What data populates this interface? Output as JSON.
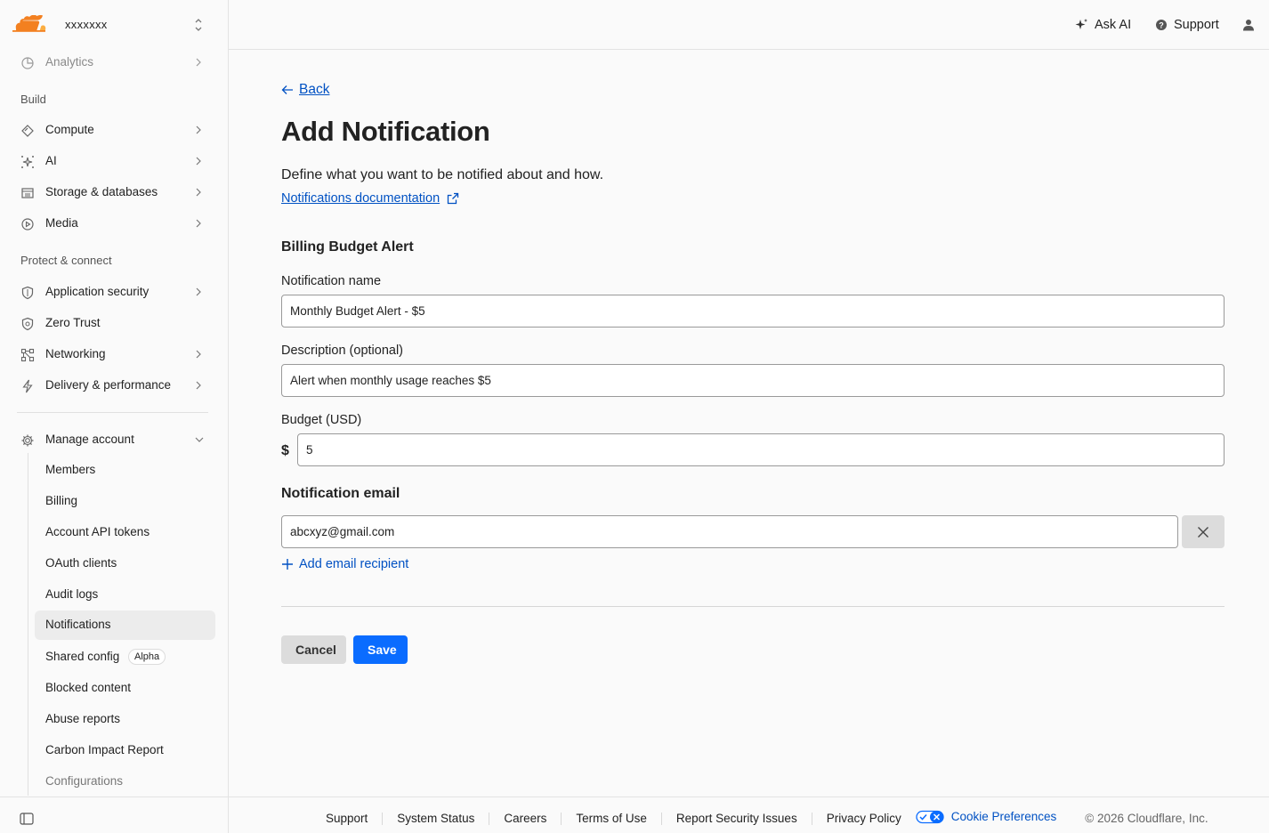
{
  "account": {
    "name": "xxxxxxx"
  },
  "topbar": {
    "ask_ai": "Ask AI",
    "support": "Support"
  },
  "sidebar": {
    "analytics": "Analytics",
    "build_heading": "Build",
    "build_items": [
      "Compute",
      "AI",
      "Storage & databases",
      "Media"
    ],
    "protect_heading": "Protect & connect",
    "protect_items": [
      "Application security",
      "Zero Trust",
      "Networking",
      "Delivery & performance"
    ],
    "manage_account": "Manage account",
    "manage_items": [
      "Members",
      "Billing",
      "Account API tokens",
      "OAuth clients",
      "Audit logs",
      "Notifications",
      "Shared config",
      "Blocked content",
      "Abuse reports",
      "Carbon Impact Report",
      "Configurations"
    ],
    "alpha_badge": "Alpha",
    "active_item": "Notifications"
  },
  "page": {
    "back": "Back",
    "title": "Add Notification",
    "intro": "Define what you want to be notified about and how.",
    "doc_link": "Notifications documentation",
    "section_title": "Billing Budget Alert",
    "name_label": "Notification name",
    "name_value": "Monthly Budget Alert - $5",
    "description_label": "Description (optional)",
    "description_value": "Alert when monthly usage reaches $5",
    "budget_label": "Budget (USD)",
    "currency_symbol": "$",
    "budget_value": "5",
    "email_section": "Notification email",
    "email_value": "abcxyz@gmail.com",
    "add_recipient": "Add email recipient",
    "cancel": "Cancel",
    "save": "Save"
  },
  "footer": {
    "links": [
      "Support",
      "System Status",
      "Careers",
      "Terms of Use",
      "Report Security Issues",
      "Privacy Policy"
    ],
    "cookie": "Cookie Preferences",
    "copyright": "© 2026 Cloudflare, Inc."
  },
  "colors": {
    "link": "#0051c3",
    "primary": "#0a6cff",
    "brand": "#f38020"
  }
}
